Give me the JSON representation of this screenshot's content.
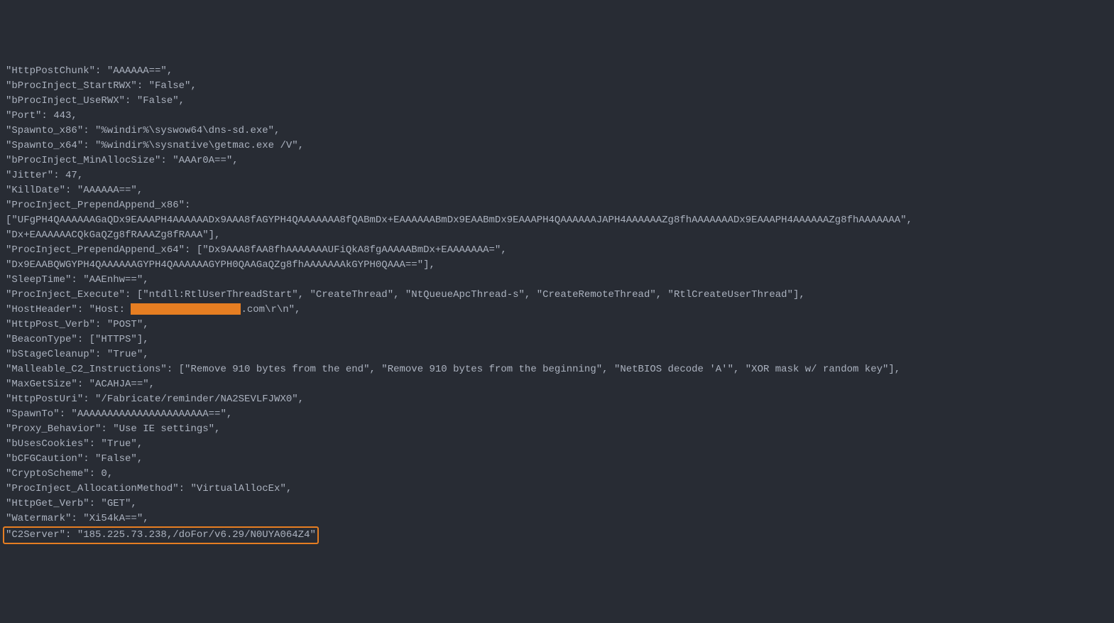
{
  "lines": [
    {
      "text": "\"HttpPostChunk\": \"AAAAAA==\","
    },
    {
      "text": "\"bProcInject_StartRWX\": \"False\","
    },
    {
      "text": "\"bProcInject_UseRWX\": \"False\","
    },
    {
      "text": "\"Port\": 443,"
    },
    {
      "text": "\"Spawnto_x86\": \"%windir%\\syswow64\\dns-sd.exe\","
    },
    {
      "text": "\"Spawnto_x64\": \"%windir%\\sysnative\\getmac.exe /V\","
    },
    {
      "text": "\"bProcInject_MinAllocSize\": \"AAAr0A==\","
    },
    {
      "text": "\"Jitter\": 47,"
    },
    {
      "text": "\"KillDate\": \"AAAAAA==\","
    },
    {
      "text": "\"ProcInject_PrependAppend_x86\":"
    },
    {
      "text": "[\"UFgPH4QAAAAAAGaQDx9EAAAPH4AAAAAADx9AAA8fAGYPH4QAAAAAAA8fQABmDx+EAAAAAABmDx9EAABmDx9EAAAPH4QAAAAAAJAPH4AAAAAAZg8fhAAAAAAADx9EAAAPH4AAAAAAZg8fhAAAAAAA\","
    },
    {
      "text": "\"Dx+EAAAAAACQkGaQZg8fRAAAZg8fRAAA\"],"
    },
    {
      "text": "\"ProcInject_PrependAppend_x64\": [\"Dx9AAA8fAA8fhAAAAAAAUFiQkA8fgAAAAABmDx+EAAAAAAA=\","
    },
    {
      "text": "\"Dx9EAABQWGYPH4QAAAAAAGYPH4QAAAAAAGYPH0QAAGaQZg8fhAAAAAAAkGYPH0QAAA==\"],"
    },
    {
      "text": "\"SleepTime\": \"AAEnhw==\","
    },
    {
      "text": "\"ProcInject_Execute\": [\"ntdll:RtlUserThreadStart\", \"CreateThread\", \"NtQueueApcThread-s\", \"CreateRemoteThread\", \"RtlCreateUserThread\"],"
    },
    {
      "type": "hostheader",
      "prefix": "\"HostHeader\": \"Host: ",
      "suffix": ".com\\r\\n\","
    },
    {
      "text": "\"HttpPost_Verb\": \"POST\","
    },
    {
      "text": "\"BeaconType\": [\"HTTPS\"],"
    },
    {
      "text": "\"bStageCleanup\": \"True\","
    },
    {
      "text": "\"Malleable_C2_Instructions\": [\"Remove 910 bytes from the end\", \"Remove 910 bytes from the beginning\", \"NetBIOS decode 'A'\", \"XOR mask w/ random key\"],"
    },
    {
      "text": "\"MaxGetSize\": \"ACAHJA==\","
    },
    {
      "text": "\"HttpPostUri\": \"/Fabricate/reminder/NA2SEVLFJWX0\","
    },
    {
      "text": "\"SpawnTo\": \"AAAAAAAAAAAAAAAAAAAAAA==\","
    },
    {
      "text": "\"Proxy_Behavior\": \"Use IE settings\","
    },
    {
      "text": "\"bUsesCookies\": \"True\","
    },
    {
      "text": "\"bCFGCaution\": \"False\","
    },
    {
      "text": "\"CryptoScheme\": 0,"
    },
    {
      "text": "\"ProcInject_AllocationMethod\": \"VirtualAllocEx\","
    },
    {
      "text": "\"HttpGet_Verb\": \"GET\","
    },
    {
      "text": "\"Watermark\": \"Xi54kA==\","
    },
    {
      "type": "highlighted",
      "text": "\"C2Server\": \"185.225.73.238,/doFor/v6.29/N0UYA064Z4\""
    }
  ]
}
